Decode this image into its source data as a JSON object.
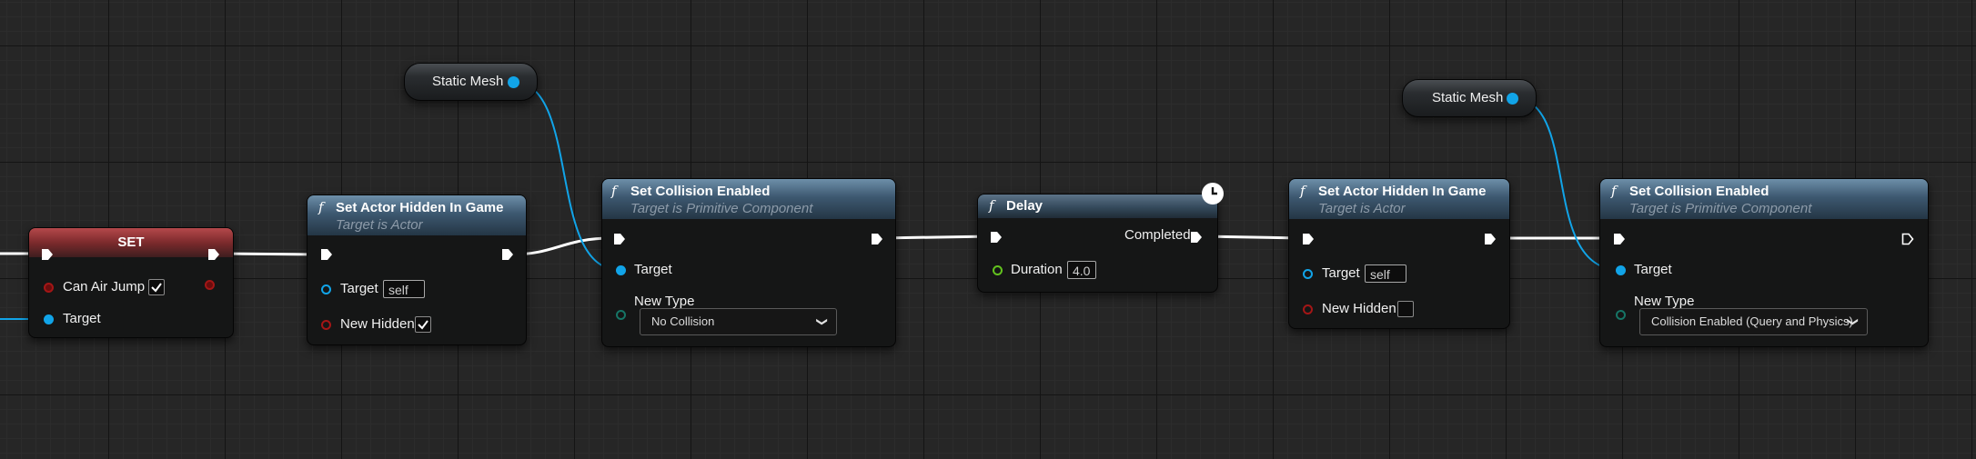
{
  "nodes": {
    "set": {
      "title": "SET",
      "can_air_jump": "Can Air Jump",
      "target": "Target"
    },
    "hidden1": {
      "title": "Set Actor Hidden In Game",
      "subtitle": "Target is Actor",
      "target": "Target",
      "target_value": "self",
      "new_hidden": "New Hidden"
    },
    "collision1": {
      "title": "Set Collision Enabled",
      "subtitle": "Target is Primitive Component",
      "target": "Target",
      "new_type": "New Type",
      "new_type_value": "No Collision"
    },
    "delay": {
      "title": "Delay",
      "completed": "Completed",
      "duration": "Duration",
      "duration_value": "4.0"
    },
    "hidden2": {
      "title": "Set Actor Hidden In Game",
      "subtitle": "Target is Actor",
      "target": "Target",
      "target_value": "self",
      "new_hidden": "New Hidden"
    },
    "collision2": {
      "title": "Set Collision Enabled",
      "subtitle": "Target is Primitive Component",
      "target": "Target",
      "new_type": "New Type",
      "new_type_value": "Collision Enabled (Query and Physics)"
    }
  },
  "variables": {
    "static_mesh_1": "Static Mesh",
    "static_mesh_2": "Static Mesh"
  },
  "icons": {
    "function": "f",
    "delay_badge": "clock-icon"
  },
  "colors": {
    "exec_wire": "#ffffff",
    "object_pin": "#11a4e8",
    "bool_pin": "#a31616",
    "float_pin": "#62c21e",
    "enum_pin": "#167566"
  }
}
